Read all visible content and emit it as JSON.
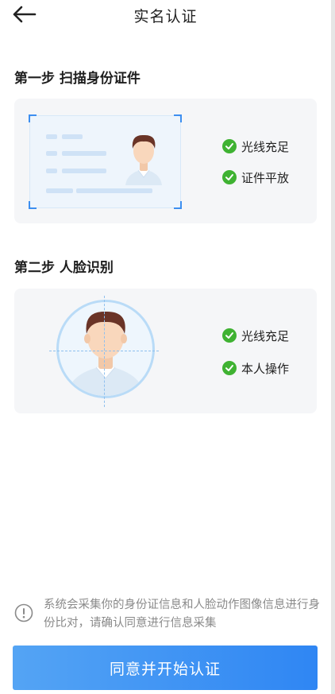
{
  "header": {
    "title": "实名认证"
  },
  "step1": {
    "title": "第一步 扫描身份证件",
    "checks": [
      {
        "label": "光线充足"
      },
      {
        "label": "证件平放"
      }
    ]
  },
  "step2": {
    "title": "第二步 人脸识别",
    "checks": [
      {
        "label": "光线充足"
      },
      {
        "label": "本人操作"
      }
    ]
  },
  "notice": {
    "text": "系统会采集你的身份证信息和人脸动作图像信息进行身份比对，请确认同意进行信息采集"
  },
  "cta": {
    "label": "同意并开始认证"
  },
  "colors": {
    "accent": "#2f86f3",
    "check": "#3fb232"
  }
}
